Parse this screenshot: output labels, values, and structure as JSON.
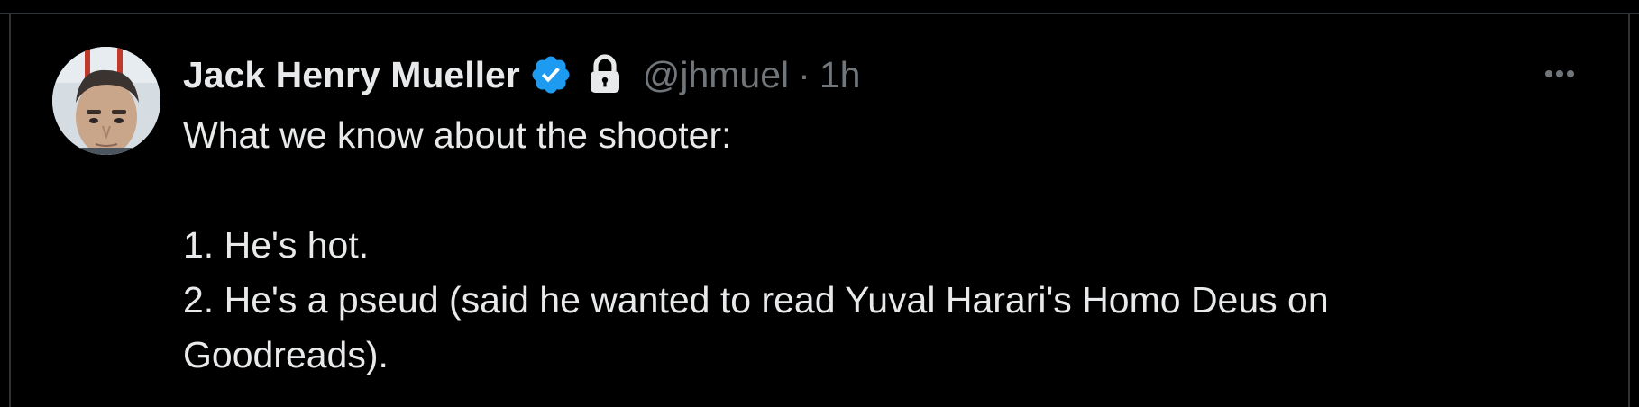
{
  "tweet": {
    "author_name": "Jack Henry Mueller",
    "handle": "@jhmuel",
    "separator": "·",
    "time": "1h",
    "text": "What we know about the shooter:\n\n1. He's hot.\n2. He's a pseud (said he wanted to read Yuval Harari's Homo Deus on Goodreads)."
  },
  "icons": {
    "verified": "verified-badge-icon",
    "lock": "lock-icon",
    "more": "more-options-icon"
  },
  "colors": {
    "background": "#000000",
    "text_primary": "#e7e9ea",
    "text_secondary": "#71767b",
    "verified_blue": "#1d9bf0",
    "border": "#2f3336"
  }
}
